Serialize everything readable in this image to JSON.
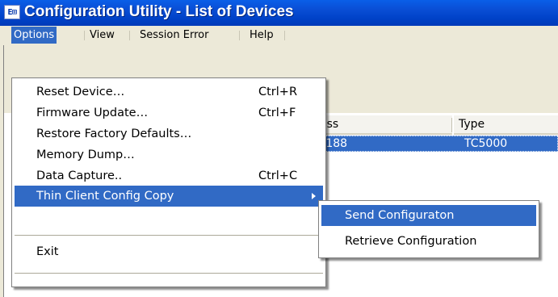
{
  "window": {
    "title": "Configuration Utility - List of Devices",
    "icon": "app-icon",
    "icon_glyph": "E⊞"
  },
  "menubar": {
    "items": [
      {
        "label": "Options",
        "active": true
      },
      {
        "label": "View"
      },
      {
        "label": "Session Error"
      },
      {
        "label": "Help"
      }
    ]
  },
  "listview": {
    "columns": [
      "…ess",
      "Type"
    ],
    "selected_row": {
      "address": "…1.188",
      "type": "TC5000"
    }
  },
  "options_menu": {
    "items": [
      {
        "label": "Reset Device…",
        "accel": "Ctrl+R"
      },
      {
        "label": "Firmware Update…",
        "accel": "Ctrl+F"
      },
      {
        "label": "Restore Factory Defaults…",
        "accel": ""
      },
      {
        "label": "Memory Dump…",
        "accel": ""
      },
      {
        "label": "Data Capture..",
        "accel": "Ctrl+C"
      },
      {
        "label": "Thin Client Config Copy",
        "accel": "",
        "submenu": true
      },
      {
        "label": "Exit",
        "accel": ""
      }
    ]
  },
  "submenu": {
    "items": [
      {
        "label": "Send Configuraton"
      },
      {
        "label": "Retrieve Configuration"
      }
    ]
  },
  "colors": {
    "titlebar": "#0a4fd6",
    "highlight": "#316ac5",
    "menubar": "#ece9d8"
  }
}
